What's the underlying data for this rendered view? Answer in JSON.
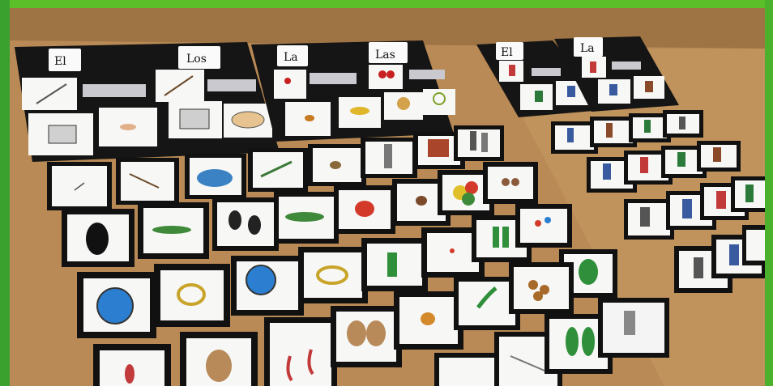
{
  "colors": {
    "border": "#5bbf2a",
    "table": "#b98a55",
    "board": "#151515",
    "card_face": "#f7f7f5",
    "slot": "#c9c9cf"
  },
  "boards": [
    {
      "labels": [
        "El",
        "Los"
      ]
    },
    {
      "labels": [
        "La",
        "Las"
      ]
    },
    {
      "labels": [
        "El"
      ]
    },
    {
      "labels": [
        "La"
      ]
    }
  ],
  "icons": [
    "needle-icon",
    "match-icon",
    "pincushion-icon",
    "toothpicks-icon",
    "button-icon",
    "doll-icon",
    "bag-icon",
    "couple-icon",
    "footprint-icon",
    "beans-icon",
    "balloon-icon",
    "rope-icon",
    "boot-icon",
    "leaf-icon",
    "drum-icon",
    "lentils-icon"
  ]
}
